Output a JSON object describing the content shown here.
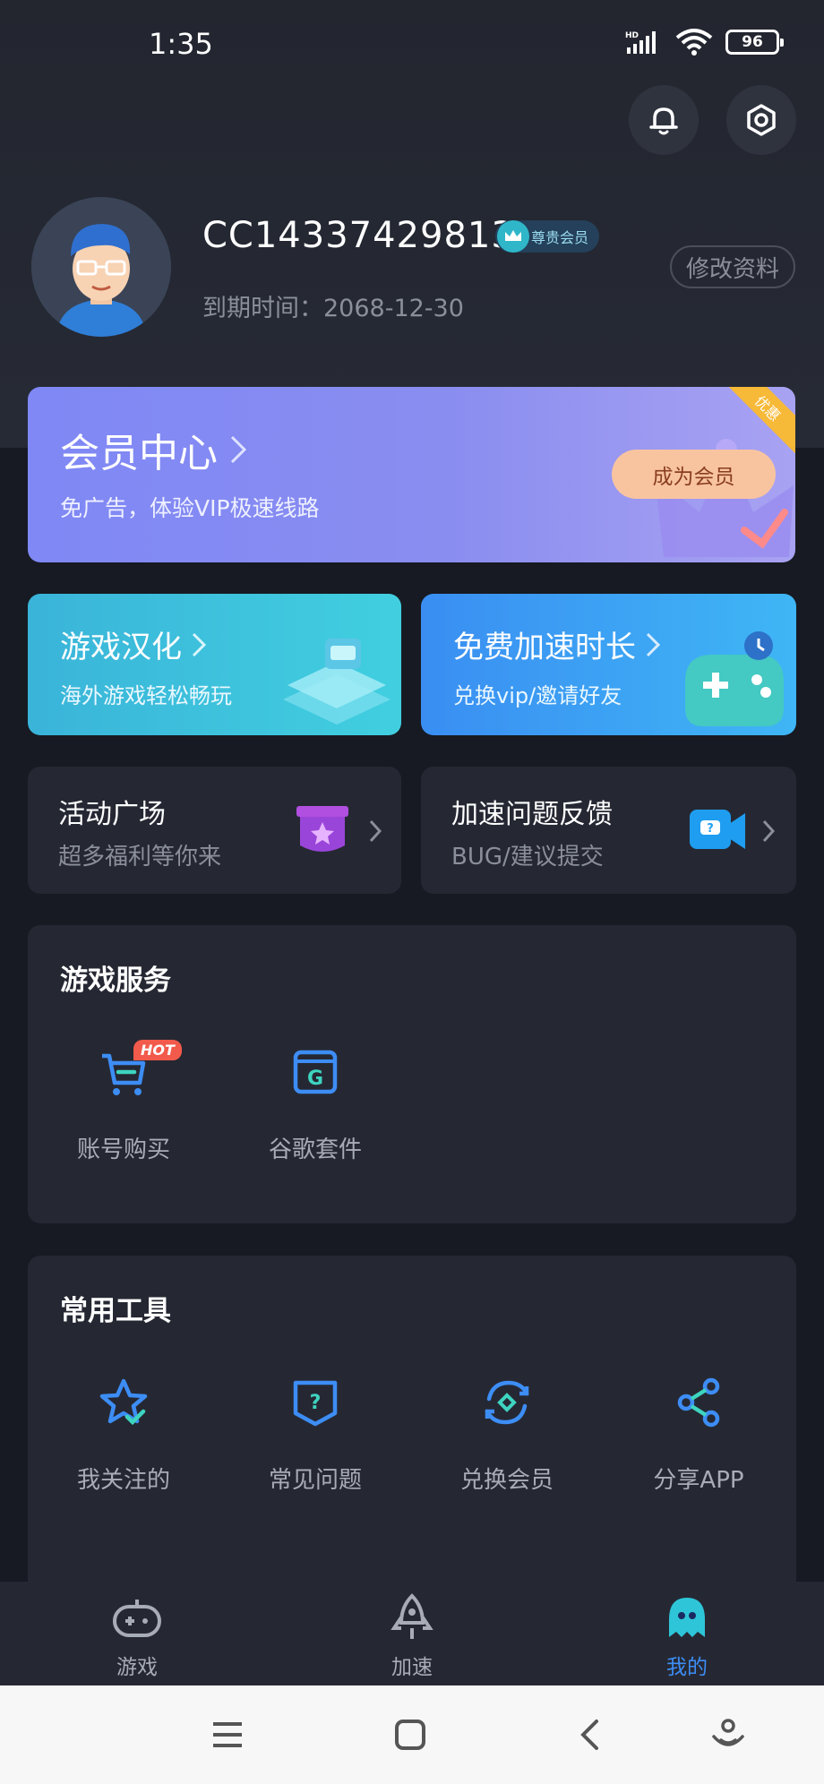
{
  "status": {
    "time": "1:35",
    "battery": "96"
  },
  "profile": {
    "username": "CC14337429813",
    "vip_label": "尊贵会员",
    "expire_text": "到期时间：2068-12-30",
    "edit_label": "修改资料"
  },
  "member": {
    "title": "会员中心",
    "subtitle": "免广告，体验VIP极速线路",
    "button": "成为会员",
    "corner": "优惠"
  },
  "features": [
    {
      "title": "游戏汉化",
      "subtitle": "海外游戏轻松畅玩"
    },
    {
      "title": "免费加速时长",
      "subtitle": "兑换vip/邀请好友"
    }
  ],
  "small_cards": [
    {
      "title": "活动广场",
      "subtitle": "超多福利等你来"
    },
    {
      "title": "加速问题反馈",
      "subtitle": "BUG/建议提交"
    }
  ],
  "game_services": {
    "title": "游戏服务",
    "hot_badge": "HOT",
    "items": [
      {
        "label": "账号购买",
        "icon": "cart-icon"
      },
      {
        "label": "谷歌套件",
        "icon": "google-icon"
      }
    ]
  },
  "tools": {
    "title": "常用工具",
    "items": [
      {
        "label": "我关注的",
        "icon": "star-icon"
      },
      {
        "label": "常见问题",
        "icon": "question-icon"
      },
      {
        "label": "兑换会员",
        "icon": "exchange-icon"
      },
      {
        "label": "分享APP",
        "icon": "share-icon"
      }
    ]
  },
  "tabs": [
    {
      "label": "游戏",
      "icon": "gamepad-icon"
    },
    {
      "label": "加速",
      "icon": "rocket-icon"
    },
    {
      "label": "我的",
      "icon": "profile-icon"
    }
  ],
  "colors": {
    "accent": "#3d8df5",
    "background": "#1a1d26",
    "card": "#252833"
  }
}
